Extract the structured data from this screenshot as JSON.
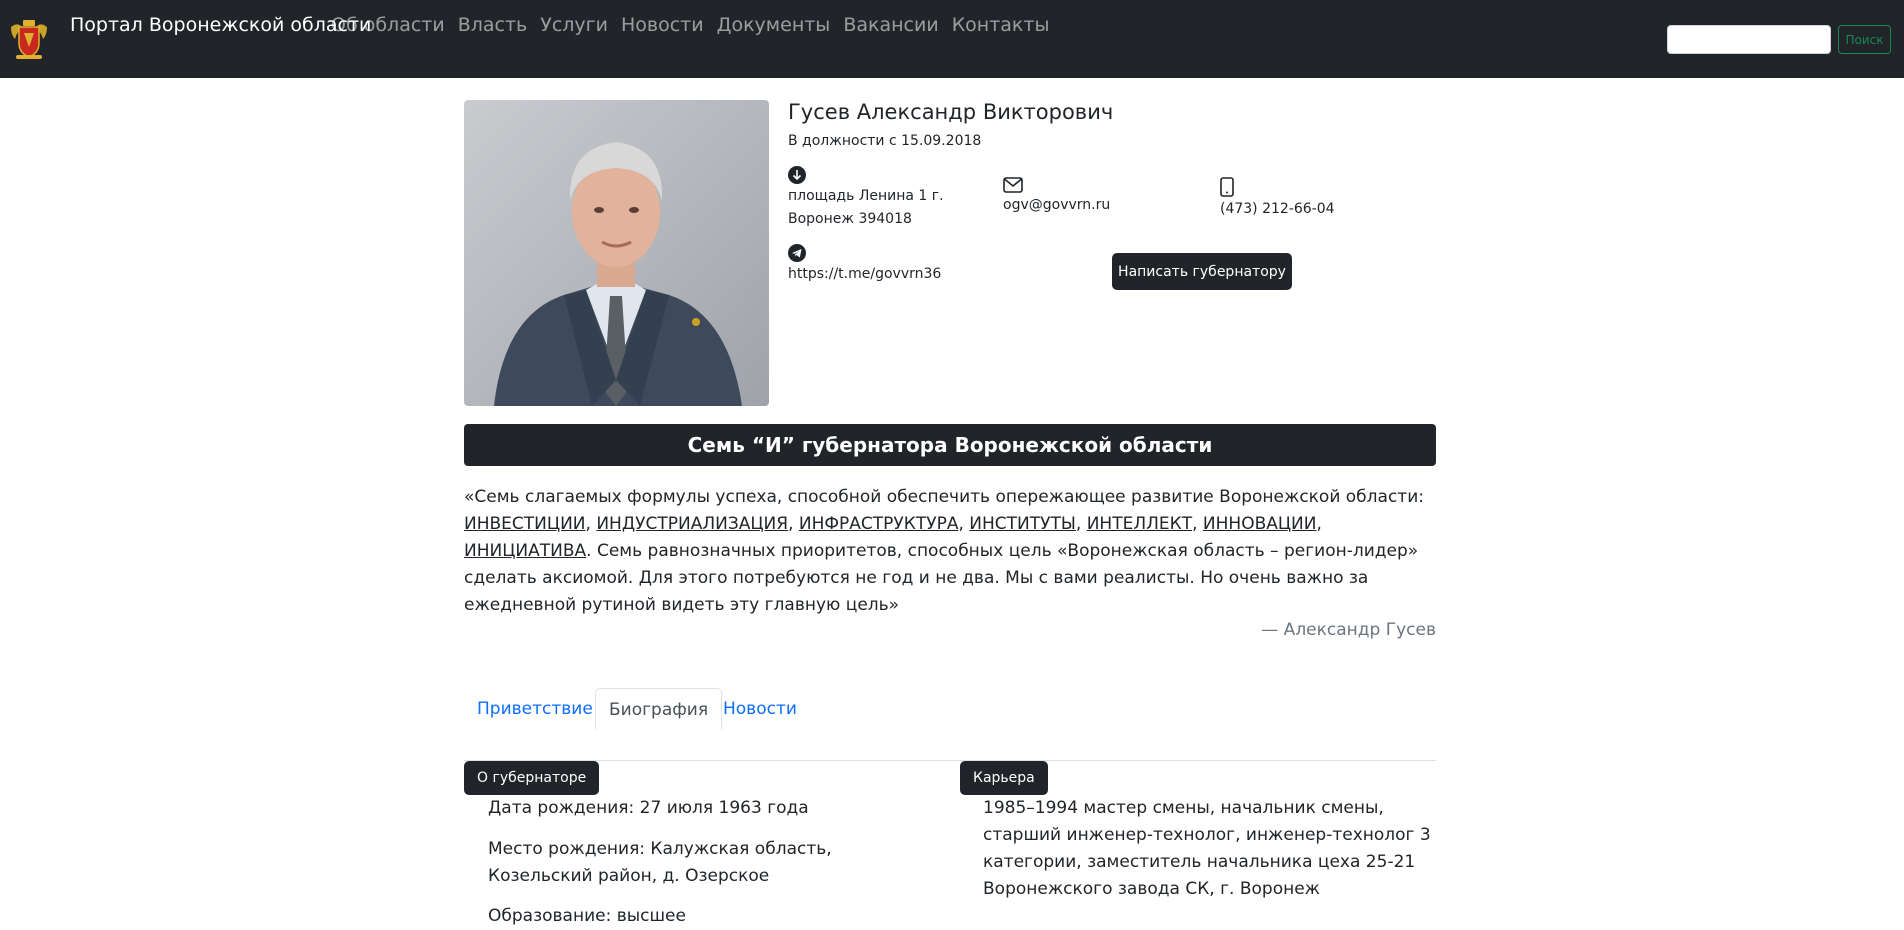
{
  "navbar": {
    "brand": "Портал Воронежской области",
    "links": [
      "Об области",
      "Власть",
      "Услуги",
      "Новости",
      "Документы",
      "Вакансии",
      "Контакты"
    ],
    "search_placeholder": "",
    "search_button": "Поиск",
    "colors": {
      "background": "#212529",
      "search_accent": "#198754"
    }
  },
  "profile": {
    "name": "Гусев Александр Викторович",
    "since": "В должности с 15.09.2018",
    "address_line1": "площадь Ленина 1 г.",
    "address_line2": "Воронеж 394018",
    "email": "ogv@govvrn.ru",
    "phone": "(473) 212-66-04",
    "telegram": "https://t.me/govvrn36",
    "write_button": "Написать губернатору",
    "icons": [
      "arrow-down-circle-icon",
      "envelope-icon",
      "phone-icon",
      "telegram-icon"
    ]
  },
  "seven_i": {
    "title": "Семь “И” губернатора Воронежской области",
    "quote_intro": "«Семь слагаемых формулы успеха, способной обеспечить опережающее развитие Воронежской области:",
    "keywords": [
      "ИНВЕСТИЦИИ",
      "ИНДУСТРИАЛИЗАЦИЯ",
      "ИНФРАСТРУКТУРА",
      "ИНСТИТУТЫ",
      "ИНТЕЛЛЕКТ",
      "ИННОВАЦИИ",
      "ИНИЦИАТИВА"
    ],
    "quote_outro": "Семь равнозначных приоритетов, способных цель «Воронежская область – регион-лидер» сделать аксиомой. Для этого потребуются не год и не два. Мы с вами реалисты. Но очень важно за ежедневной рутиной видеть эту главную цель»",
    "author": "— Александр Гусев"
  },
  "tabs": [
    {
      "label": "Приветствие",
      "active": false
    },
    {
      "label": "Биография",
      "active": true
    },
    {
      "label": "Новости",
      "active": false
    }
  ],
  "bio": {
    "about_badge": "О губернаторе",
    "birth_date": "Дата рождения: 27 июля 1963 года",
    "birth_place": "Место рождения: Калужская область, Козельский район, д. Озерское",
    "education": "Образование: высшее",
    "career_badge": "Карьера",
    "career_first": "1985–1994 мастер смены, начальник смены, старший инженер-технолог, инженер-технолог 3 категории, заместитель начальника цеха 25-21 Воронежского завода СК, г. Воронеж"
  }
}
